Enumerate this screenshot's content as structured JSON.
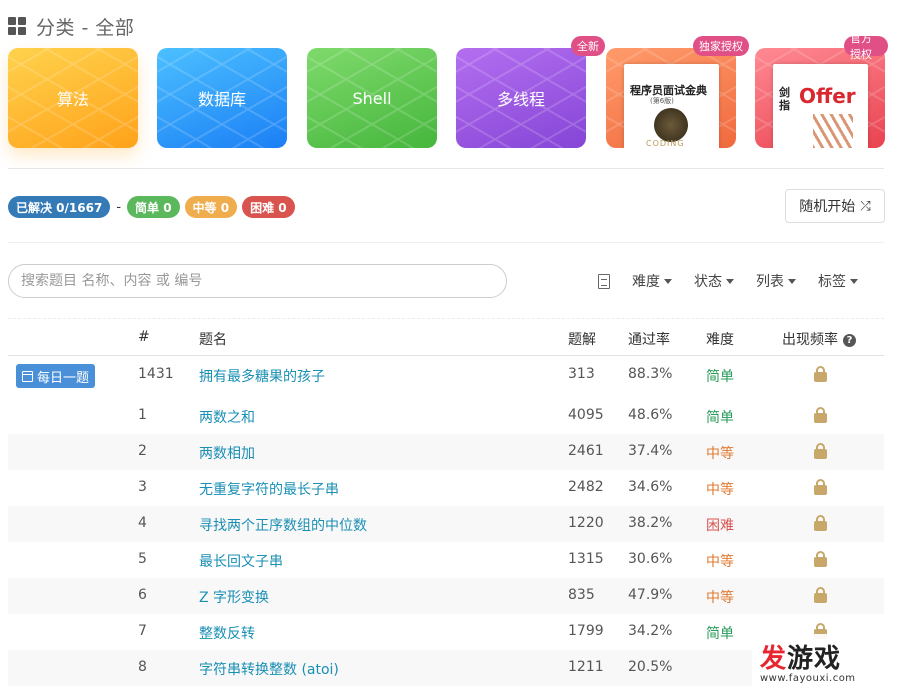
{
  "header": {
    "title": "分类 - 全部",
    "icon": "grid-icon"
  },
  "categories": [
    {
      "label": "算法",
      "color": "#ffa21a"
    },
    {
      "label": "数据库",
      "color": "#1b7ff5"
    },
    {
      "label": "Shell",
      "color": "#45b63c"
    },
    {
      "label": "多线程",
      "color": "#8545d6"
    }
  ],
  "books": [
    {
      "badge": "全新",
      "cover_title": "程序员面试金典",
      "cover_sub": "(第6版)",
      "cover_wm": "CODING"
    },
    {
      "badge": "独家授权",
      "cover_title": "Offer",
      "cover_side": "剑指"
    },
    {
      "badge": "官方授权"
    }
  ],
  "stats": {
    "solved": "已解决 0/1667",
    "sep": "-",
    "easy": "简单 0",
    "medium": "中等 0",
    "hard": "困难 0"
  },
  "random_button": {
    "label": "随机开始",
    "icon": "shuffle-icon"
  },
  "search": {
    "placeholder": "搜索题目 名称、内容 或 编号",
    "value": ""
  },
  "filters": [
    "难度",
    "状态",
    "列表",
    "标签"
  ],
  "table": {
    "headers": {
      "num": "#",
      "title": "题名",
      "solutions": "题解",
      "rate": "通过率",
      "difficulty": "难度",
      "frequency": "出现频率"
    },
    "daily_label": "每日一题",
    "rows": [
      {
        "num": "1431",
        "title": "拥有最多糖果的孩子",
        "solutions": "313",
        "rate": "88.3%",
        "difficulty": "简单",
        "level": "easy"
      },
      {
        "num": "1",
        "title": "两数之和",
        "solutions": "4095",
        "rate": "48.6%",
        "difficulty": "简单",
        "level": "easy"
      },
      {
        "num": "2",
        "title": "两数相加",
        "solutions": "2461",
        "rate": "37.4%",
        "difficulty": "中等",
        "level": "medium"
      },
      {
        "num": "3",
        "title": "无重复字符的最长子串",
        "solutions": "2482",
        "rate": "34.6%",
        "difficulty": "中等",
        "level": "medium"
      },
      {
        "num": "4",
        "title": "寻找两个正序数组的中位数",
        "solutions": "1220",
        "rate": "38.2%",
        "difficulty": "困难",
        "level": "hard"
      },
      {
        "num": "5",
        "title": "最长回文子串",
        "solutions": "1315",
        "rate": "30.6%",
        "difficulty": "中等",
        "level": "medium"
      },
      {
        "num": "6",
        "title": "Z 字形变换",
        "solutions": "835",
        "rate": "47.9%",
        "difficulty": "中等",
        "level": "medium"
      },
      {
        "num": "7",
        "title": "整数反转",
        "solutions": "1799",
        "rate": "34.2%",
        "difficulty": "简单",
        "level": "easy"
      },
      {
        "num": "8",
        "title": "字符串转换整数 (atoi)",
        "solutions": "1211",
        "rate": "20.5%",
        "difficulty": "",
        "level": "medium"
      }
    ]
  },
  "watermark": {
    "logo_red": "发",
    "logo_black": "游戏",
    "url": "www.fayouxi.com"
  }
}
